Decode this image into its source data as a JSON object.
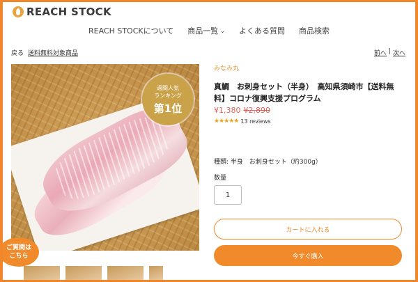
{
  "header": {
    "logo_text": "REACH STOCK",
    "nav": [
      {
        "label": "REACH STOCKについて"
      },
      {
        "label": "商品一覧",
        "chevron": "⌄"
      },
      {
        "label": "よくある質問"
      },
      {
        "label": "商品検索"
      }
    ]
  },
  "breadcrumb": {
    "back": "戻る",
    "category": "送料無料対象商品"
  },
  "pager": {
    "prev": "前へ",
    "separator": "|",
    "next": "次へ"
  },
  "image": {
    "rank_line1": "週間人気",
    "rank_line2": "ランキング",
    "rank_line3": "第1位",
    "faq_line1": "ご質問は",
    "faq_line2": "こちら"
  },
  "product": {
    "brand": "みなみ丸",
    "title": "真鯛　お刺身セット（半身）　高知県須崎市【送料無料】コロナ復興支援プログラム",
    "price_sale": "¥1,380",
    "price_original": "¥2,890",
    "stars": "★★★★★",
    "reviews": "13 reviews",
    "variant": "種類: 半身　お刺身セット（約300g）",
    "quantity_label": "数量",
    "quantity_value": "1",
    "add_to_cart": "カートに入れる",
    "buy_now": "今すぐ購入"
  },
  "colors": {
    "accent": "#f08a2a",
    "sale": "#e0625a",
    "brand": "#e69a3c"
  }
}
